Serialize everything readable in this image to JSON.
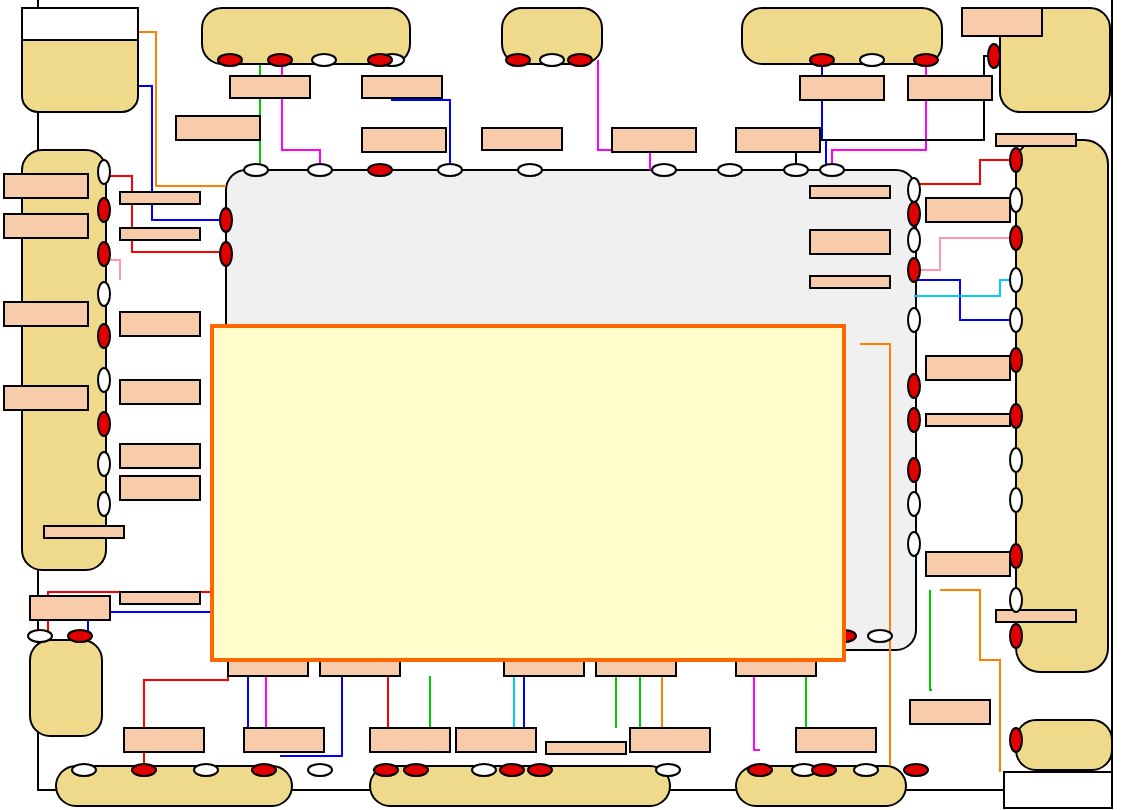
{
  "diagram": {
    "kind": "block-diagram"
  }
}
